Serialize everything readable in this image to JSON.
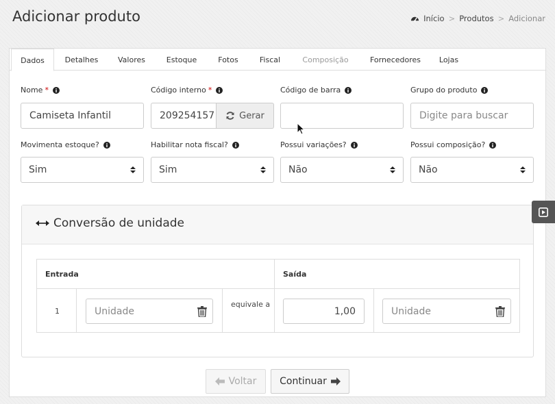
{
  "header": {
    "title": "Adicionar produto",
    "breadcrumb": [
      "Início",
      "Produtos",
      "Adicionar"
    ]
  },
  "tabs": [
    {
      "label": "Dados",
      "state": "active"
    },
    {
      "label": "Detalhes",
      "state": "normal"
    },
    {
      "label": "Valores",
      "state": "normal"
    },
    {
      "label": "Estoque",
      "state": "normal"
    },
    {
      "label": "Fotos",
      "state": "normal"
    },
    {
      "label": "Fiscal",
      "state": "normal"
    },
    {
      "label": "Composição",
      "state": "disabled"
    },
    {
      "label": "Fornecedores",
      "state": "normal"
    },
    {
      "label": "Lojas",
      "state": "normal"
    }
  ],
  "form": {
    "nome": {
      "label": "Nome",
      "required": "*",
      "value": "Camiseta Infantil"
    },
    "codigo_interno": {
      "label": "Código interno",
      "required": "*",
      "value": "209254157",
      "button": "Gerar"
    },
    "codigo_barra": {
      "label": "Código de barra",
      "value": ""
    },
    "grupo": {
      "label": "Grupo do produto",
      "placeholder": "Digite para buscar"
    },
    "movimenta_estoque": {
      "label": "Movimenta estoque?",
      "value": "Sim"
    },
    "nota_fiscal": {
      "label": "Habilitar nota fiscal?",
      "value": "Sim"
    },
    "variacoes": {
      "label": "Possui variações?",
      "value": "Não"
    },
    "composicao": {
      "label": "Possui composição?",
      "value": "Não"
    }
  },
  "conversion": {
    "title": "Conversão de unidade",
    "entrada_header": "Entrada",
    "saida_header": "Saída",
    "entrada_qty": "1",
    "entrada_unit_placeholder": "Unidade",
    "equivale": "equivale a",
    "saida_qty": "1,00",
    "saida_unit_placeholder": "Unidade"
  },
  "footer": {
    "back_label": "Voltar",
    "next_label": "Continuar"
  },
  "colors": {
    "required": "#cc0000",
    "toggle": "#555555"
  }
}
